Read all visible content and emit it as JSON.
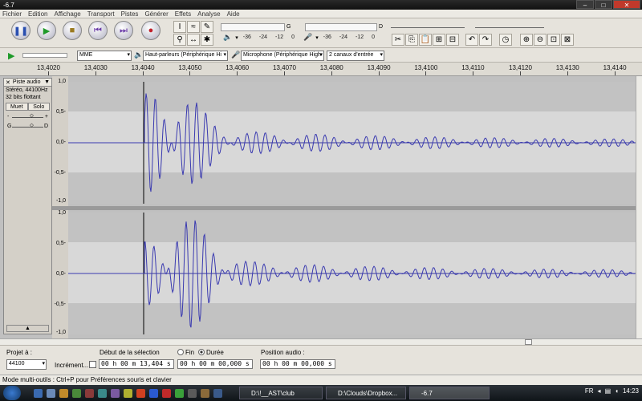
{
  "window": {
    "title": "-6.7"
  },
  "menu": [
    "Fichier",
    "Edition",
    "Affichage",
    "Transport",
    "Pistes",
    "Générer",
    "Effets",
    "Analyse",
    "Aide"
  ],
  "meters": {
    "ticks": [
      "-36",
      "-24",
      "-12",
      "0"
    ],
    "channel_g": "G",
    "channel_d": "D"
  },
  "device": {
    "host": "MME",
    "output": "Haut-parleurs (Périphérique Hi",
    "input": "Microphone (Périphérique High",
    "channels": "2 canaux d'entrée"
  },
  "ruler": {
    "labels": [
      "13,4020",
      "13,4030",
      "13,4040",
      "13,4050",
      "13,4060",
      "13,4070",
      "13,4080",
      "13,4090",
      "13,4100",
      "13,4110",
      "13,4120",
      "13,4130",
      "13,4140"
    ]
  },
  "track": {
    "name": "Piste audio",
    "format": "Stéréo, 44100Hz",
    "bits": "32 bits flottant",
    "mute": "Muet",
    "solo": "Solo",
    "pan_left": "G",
    "pan_right": "D",
    "scale": [
      "1,0",
      "0,5-",
      "0,0-",
      "-0,5-",
      "-1,0"
    ]
  },
  "selection": {
    "project_rate_label": "Projet à :",
    "project_rate": "44100",
    "snap_label": "Incrément...",
    "start_label": "Début de la sélection",
    "end_label": "Fin",
    "duration_label": "Durée",
    "start_value": "00 h 00 m 13,404 s",
    "duration_value": "00 h 00 m 00,000 s",
    "position_label": "Position audio :",
    "position_value": "00 h 00 m 00,000 s"
  },
  "status": "Mode multi-outils : Ctrl+P pour Préférences souris et clavier",
  "taskbar": {
    "tasks": [
      "D:\\!__AST\\club",
      "D:\\Clouds\\Dropbox...",
      "-6.7"
    ],
    "lang": "FR",
    "clock": "14:23"
  }
}
